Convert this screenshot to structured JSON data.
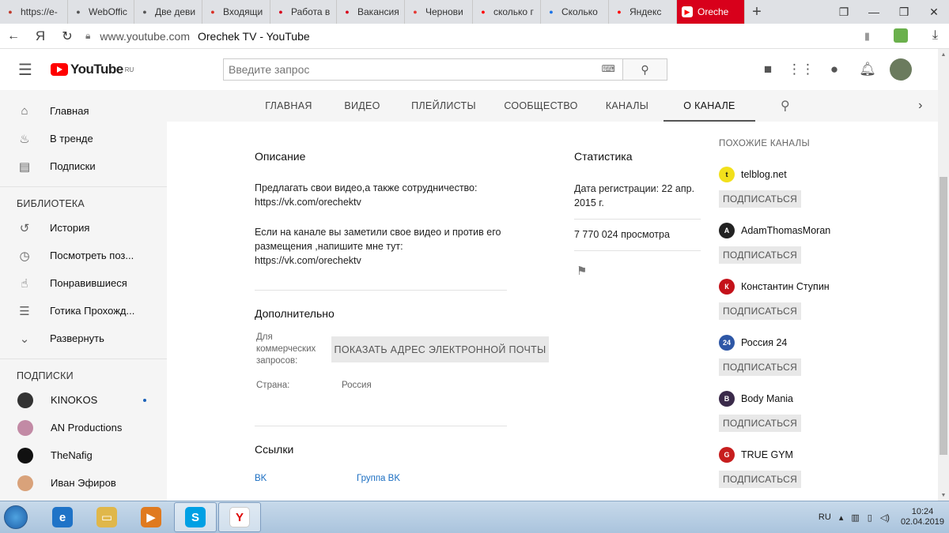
{
  "browser": {
    "tabs": [
      {
        "label": "https://e-",
        "icon": "graduation-cap-icon",
        "color": "#c0392b"
      },
      {
        "label": "WebOffic",
        "icon": "webofficer-icon",
        "color": "#555555"
      },
      {
        "label": "Две деви",
        "icon": "camera-icon",
        "color": "#555555"
      },
      {
        "label": "Входящи",
        "icon": "gmail-icon",
        "color": "#d93025"
      },
      {
        "label": "Работа в",
        "icon": "hh-icon",
        "color": "#d8001b"
      },
      {
        "label": "Вакансия",
        "icon": "hh-icon",
        "color": "#d8001b"
      },
      {
        "label": "Чернови",
        "icon": "zen-icon",
        "color": "#e53935"
      },
      {
        "label": "сколько г",
        "icon": "yandex-icon",
        "color": "#ff0000"
      },
      {
        "label": "Сколько",
        "icon": "gear-icon",
        "color": "#1a73e8"
      },
      {
        "label": "Яндекс",
        "icon": "yandex-icon",
        "color": "#ff0000"
      },
      {
        "label": "Oreche",
        "icon": "youtube-icon",
        "color": "#ff0000",
        "active": true
      }
    ],
    "nav_back_icon": "back-arrow-icon",
    "yandex_button": "Я",
    "url": "www.youtube.com",
    "page_title": "Orechek TV - YouTube"
  },
  "youtube": {
    "logo_text": "YouTube",
    "logo_region": "RU",
    "search_placeholder": "Введите запрос"
  },
  "sidebar": {
    "main": [
      {
        "label": "Главная",
        "icon": "home-icon",
        "glyph": "⌂"
      },
      {
        "label": "В тренде",
        "icon": "flame-icon",
        "glyph": "♨"
      },
      {
        "label": "Подписки",
        "icon": "subscriptions-icon",
        "glyph": "▤"
      }
    ],
    "library_title": "БИБЛИОТЕКА",
    "library": [
      {
        "label": "История",
        "icon": "history-icon",
        "glyph": "↺"
      },
      {
        "label": "Посмотреть поз...",
        "icon": "clock-icon",
        "glyph": "◷"
      },
      {
        "label": "Понравившиеся",
        "icon": "thumbs-up-icon",
        "glyph": "☝"
      },
      {
        "label": "Готика Прохожд...",
        "icon": "playlist-icon",
        "glyph": "☰"
      },
      {
        "label": "Развернуть",
        "icon": "chevron-down-icon",
        "glyph": "⌄"
      }
    ],
    "subs_title": "ПОДПИСКИ",
    "subs": [
      {
        "label": "KINOKOS",
        "color": "#333333",
        "dot": true
      },
      {
        "label": "AN Productions",
        "color": "#c28aa5",
        "dot": false
      },
      {
        "label": "TheNafig",
        "color": "#111111",
        "dot": false
      },
      {
        "label": "Иван Эфиров",
        "color": "#d9a27a",
        "dot": false
      }
    ]
  },
  "channel_tabs": [
    {
      "label": "ГЛАВНАЯ",
      "w": 100
    },
    {
      "label": "ВИДЕО",
      "w": 86
    },
    {
      "label": "ПЛЕЙЛИСТЫ",
      "w": 120
    },
    {
      "label": "СООБЩЕСТВО",
      "w": 126
    },
    {
      "label": "КАНАЛЫ",
      "w": 92
    },
    {
      "label": "О КАНАЛЕ",
      "w": 116,
      "active": true
    }
  ],
  "about": {
    "description_title": "Описание",
    "desc_p1_l1": "Предлагать свои видео,а также сотрудничество:",
    "desc_p1_l2": "https://vk.com/orechektv",
    "desc_p2_l1": "Если на канале вы заметили свое видео и против его",
    "desc_p2_l2": "размещения ,напишите мне тут:",
    "desc_p2_l3": "https://vk.com/orechektv",
    "details_title": "Дополнительно",
    "business_l1": "Для",
    "business_l2": "коммерческих",
    "business_l3": "запросов:",
    "email_button": "ПОКАЗАТЬ АДРЕС ЭЛЕКТРОННОЙ ПОЧТЫ",
    "country_label": "Страна:",
    "country_value": "Россия",
    "links_title": "Ссылки",
    "link1": "BK",
    "link2": "Группа BK"
  },
  "stats": {
    "title": "Статистика",
    "joined_l1": "Дата регистрации: 22 апр.",
    "joined_l2": "2015 г.",
    "views": "7 770 024 просмотра",
    "flag_icon": "flag-icon"
  },
  "related": {
    "title": "ПОХОЖИЕ КАНАЛЫ",
    "subscribe_label": "ПОДПИСАТЬСЯ",
    "channels": [
      {
        "name": "telblog.net",
        "color": "#f2e01b",
        "text": "t"
      },
      {
        "name": "AdamThomasMoran",
        "color": "#222222",
        "text": "A"
      },
      {
        "name": "Константин Ступин",
        "color": "#c4121a",
        "text": "К"
      },
      {
        "name": "Россия 24",
        "color": "#2e57a6",
        "text": "24"
      },
      {
        "name": "Body Mania",
        "color": "#3a2a4a",
        "text": "B"
      },
      {
        "name": "TRUE GYM",
        "color": "#c71e1e",
        "text": "G"
      }
    ]
  },
  "taskbar": {
    "apps": [
      {
        "name": "internet-explorer-icon",
        "color": "#1f73c7",
        "text": "e",
        "open": false
      },
      {
        "name": "file-explorer-icon",
        "color": "#e0b74a",
        "text": "▭",
        "open": false
      },
      {
        "name": "media-player-icon",
        "color": "#e07a1f",
        "text": "▶",
        "open": false
      },
      {
        "name": "skype-icon",
        "color": "#00a0e4",
        "text": "S",
        "open": true
      },
      {
        "name": "yandex-browser-icon",
        "color": "#ffffff",
        "text": "Y",
        "open": true
      }
    ],
    "lang": "RU",
    "time": "10:24",
    "date": "02.04.2019"
  }
}
